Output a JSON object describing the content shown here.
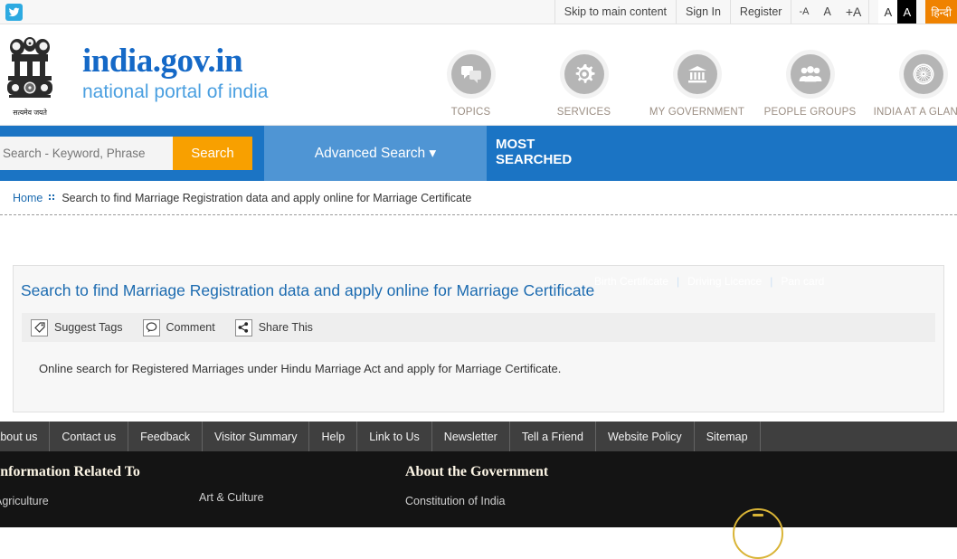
{
  "topbar": {
    "social": {
      "icon": "twitter-icon",
      "label": "Twitter"
    },
    "links": [
      {
        "label": "Skip to main content",
        "name": "skip-to-main-content-link"
      },
      {
        "label": "Sign In",
        "name": "sign-in-link"
      },
      {
        "label": "Register",
        "name": "register-link"
      }
    ],
    "font_sizes": [
      {
        "label": "-A",
        "name": "decrease-font-size-button"
      },
      {
        "label": "A",
        "name": "default-font-size-button"
      },
      {
        "label": "+A",
        "name": "increase-font-size-button"
      }
    ],
    "contrast": [
      {
        "label": "A",
        "name": "normal-contrast-button"
      },
      {
        "label": "A",
        "name": "high-contrast-button"
      }
    ],
    "language_toggle": {
      "label": "हिन्दी",
      "name": "hindi-language-button"
    }
  },
  "header": {
    "emblem_caption": "सत्यमेव जयते",
    "brand_title": "india.gov.in",
    "brand_subtitle": "national portal of india",
    "nav": [
      {
        "label": "TOPICS",
        "icon": "chat-bubbles-icon"
      },
      {
        "label": "SERVICES",
        "icon": "gear-icon"
      },
      {
        "label": "MY GOVERNMENT",
        "icon": "bank-building-icon"
      },
      {
        "label": "PEOPLE GROUPS",
        "icon": "people-group-icon"
      },
      {
        "label": "INDIA AT A GLANCE",
        "icon": "ashoka-chakra-icon"
      }
    ]
  },
  "search": {
    "placeholder": "Search - Keyword, Phrase",
    "value": "",
    "button_label": "Search",
    "advanced_label": "Advanced Search ▾",
    "most_searched_line1": "MOST",
    "most_searched_line2": "SEARCHED",
    "most_searched_links": [
      "Birth Certificate",
      "Driving Licence",
      "Pan card"
    ],
    "separator": "|"
  },
  "breadcrumb": {
    "home": "Home",
    "current": "Search to find Marriage Registration data and apply online for Marriage Certificate"
  },
  "content": {
    "title": "Search to find Marriage Registration data and apply online for Marriage Certificate",
    "actions": [
      {
        "label": "Suggest Tags",
        "icon": "tag-icon",
        "name": "suggest-tags-button"
      },
      {
        "label": "Comment",
        "icon": "comment-bubble-icon",
        "name": "comment-button"
      },
      {
        "label": "Share This",
        "icon": "share-icon",
        "name": "share-this-button"
      }
    ],
    "description": "Online search for Registered Marriages under Hindu Marriage Act and apply for Marriage Certificate."
  },
  "footer_nav": [
    "About us",
    "Contact us",
    "Feedback",
    "Visitor Summary",
    "Help",
    "Link to Us",
    "Newsletter",
    "Tell a Friend",
    "Website Policy",
    "Sitemap"
  ],
  "footer": {
    "col_information_title": "Information Related To",
    "col_information_link1": "Agriculture",
    "col_information_link2": "Art & Culture",
    "col_about_title": "About the Government",
    "col_about_link1": "Constitution of India"
  },
  "colors": {
    "brand_blue": "#1569c7",
    "band_blue": "#1b74c4",
    "accent_orange": "#f8a000",
    "lang_orange": "#ef8200",
    "footer_dark": "#141414",
    "footer_nav": "#3f3f3f",
    "gold": "#d9b436"
  }
}
